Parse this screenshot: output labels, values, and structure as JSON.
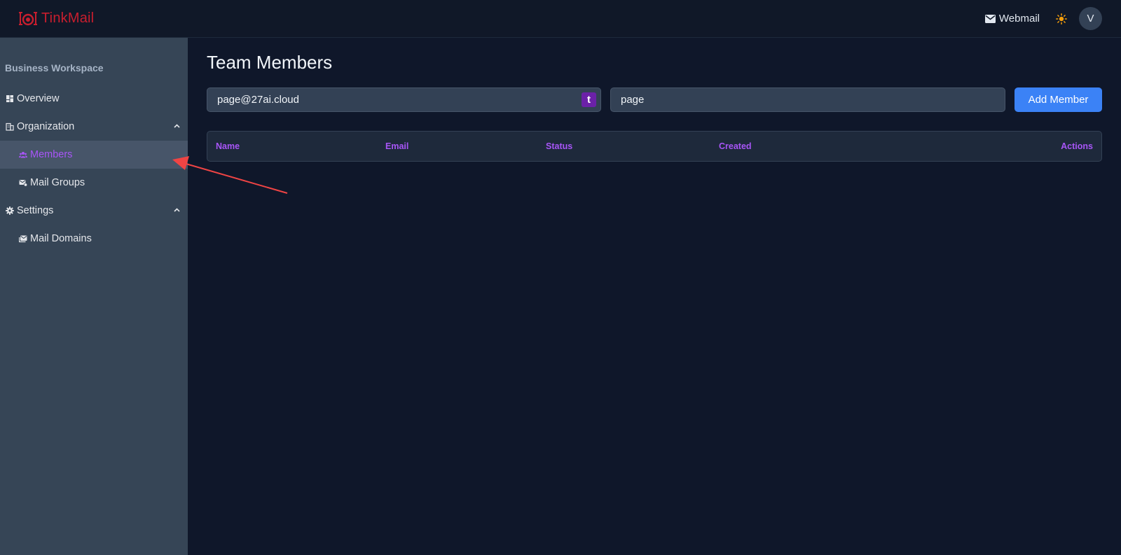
{
  "app": {
    "name": "TinkMail"
  },
  "header": {
    "webmail_label": "Webmail",
    "avatar_initial": "V"
  },
  "sidebar": {
    "workspace_title": "Business Workspace",
    "items": [
      {
        "label": "Overview",
        "icon": "dashboard-icon"
      },
      {
        "label": "Organization",
        "icon": "building-icon",
        "expanded": true
      },
      {
        "label": "Members",
        "icon": "users-icon",
        "active": true
      },
      {
        "label": "Mail Groups",
        "icon": "mail-group-icon"
      },
      {
        "label": "Settings",
        "icon": "gear-icon",
        "expanded": true
      },
      {
        "label": "Mail Domains",
        "icon": "mail-domain-icon"
      }
    ]
  },
  "main": {
    "title": "Team Members",
    "email_value": "page@27ai.cloud",
    "email_badge": "t",
    "name_value": "page",
    "add_button": "Add Member",
    "table": {
      "columns": [
        "Name",
        "Email",
        "Status",
        "Created",
        "Actions"
      ],
      "rows": []
    }
  },
  "colors": {
    "accent": "#a855f7",
    "primary": "#3b82f6",
    "brand": "#c81e2e",
    "annotation": "#ef4444"
  }
}
